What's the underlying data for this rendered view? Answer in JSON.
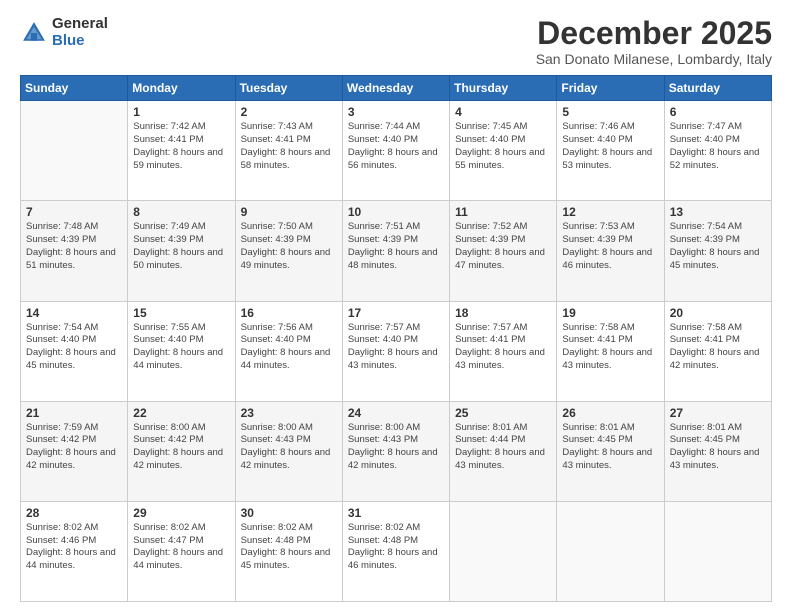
{
  "logo": {
    "general": "General",
    "blue": "Blue"
  },
  "title": {
    "month": "December 2025",
    "location": "San Donato Milanese, Lombardy, Italy"
  },
  "weekdays": [
    "Sunday",
    "Monday",
    "Tuesday",
    "Wednesday",
    "Thursday",
    "Friday",
    "Saturday"
  ],
  "weeks": [
    [
      {
        "day": "",
        "sunrise": "",
        "sunset": "",
        "daylight": ""
      },
      {
        "day": "1",
        "sunrise": "Sunrise: 7:42 AM",
        "sunset": "Sunset: 4:41 PM",
        "daylight": "Daylight: 8 hours and 59 minutes."
      },
      {
        "day": "2",
        "sunrise": "Sunrise: 7:43 AM",
        "sunset": "Sunset: 4:41 PM",
        "daylight": "Daylight: 8 hours and 58 minutes."
      },
      {
        "day": "3",
        "sunrise": "Sunrise: 7:44 AM",
        "sunset": "Sunset: 4:40 PM",
        "daylight": "Daylight: 8 hours and 56 minutes."
      },
      {
        "day": "4",
        "sunrise": "Sunrise: 7:45 AM",
        "sunset": "Sunset: 4:40 PM",
        "daylight": "Daylight: 8 hours and 55 minutes."
      },
      {
        "day": "5",
        "sunrise": "Sunrise: 7:46 AM",
        "sunset": "Sunset: 4:40 PM",
        "daylight": "Daylight: 8 hours and 53 minutes."
      },
      {
        "day": "6",
        "sunrise": "Sunrise: 7:47 AM",
        "sunset": "Sunset: 4:40 PM",
        "daylight": "Daylight: 8 hours and 52 minutes."
      }
    ],
    [
      {
        "day": "7",
        "sunrise": "Sunrise: 7:48 AM",
        "sunset": "Sunset: 4:39 PM",
        "daylight": "Daylight: 8 hours and 51 minutes."
      },
      {
        "day": "8",
        "sunrise": "Sunrise: 7:49 AM",
        "sunset": "Sunset: 4:39 PM",
        "daylight": "Daylight: 8 hours and 50 minutes."
      },
      {
        "day": "9",
        "sunrise": "Sunrise: 7:50 AM",
        "sunset": "Sunset: 4:39 PM",
        "daylight": "Daylight: 8 hours and 49 minutes."
      },
      {
        "day": "10",
        "sunrise": "Sunrise: 7:51 AM",
        "sunset": "Sunset: 4:39 PM",
        "daylight": "Daylight: 8 hours and 48 minutes."
      },
      {
        "day": "11",
        "sunrise": "Sunrise: 7:52 AM",
        "sunset": "Sunset: 4:39 PM",
        "daylight": "Daylight: 8 hours and 47 minutes."
      },
      {
        "day": "12",
        "sunrise": "Sunrise: 7:53 AM",
        "sunset": "Sunset: 4:39 PM",
        "daylight": "Daylight: 8 hours and 46 minutes."
      },
      {
        "day": "13",
        "sunrise": "Sunrise: 7:54 AM",
        "sunset": "Sunset: 4:39 PM",
        "daylight": "Daylight: 8 hours and 45 minutes."
      }
    ],
    [
      {
        "day": "14",
        "sunrise": "Sunrise: 7:54 AM",
        "sunset": "Sunset: 4:40 PM",
        "daylight": "Daylight: 8 hours and 45 minutes."
      },
      {
        "day": "15",
        "sunrise": "Sunrise: 7:55 AM",
        "sunset": "Sunset: 4:40 PM",
        "daylight": "Daylight: 8 hours and 44 minutes."
      },
      {
        "day": "16",
        "sunrise": "Sunrise: 7:56 AM",
        "sunset": "Sunset: 4:40 PM",
        "daylight": "Daylight: 8 hours and 44 minutes."
      },
      {
        "day": "17",
        "sunrise": "Sunrise: 7:57 AM",
        "sunset": "Sunset: 4:40 PM",
        "daylight": "Daylight: 8 hours and 43 minutes."
      },
      {
        "day": "18",
        "sunrise": "Sunrise: 7:57 AM",
        "sunset": "Sunset: 4:41 PM",
        "daylight": "Daylight: 8 hours and 43 minutes."
      },
      {
        "day": "19",
        "sunrise": "Sunrise: 7:58 AM",
        "sunset": "Sunset: 4:41 PM",
        "daylight": "Daylight: 8 hours and 43 minutes."
      },
      {
        "day": "20",
        "sunrise": "Sunrise: 7:58 AM",
        "sunset": "Sunset: 4:41 PM",
        "daylight": "Daylight: 8 hours and 42 minutes."
      }
    ],
    [
      {
        "day": "21",
        "sunrise": "Sunrise: 7:59 AM",
        "sunset": "Sunset: 4:42 PM",
        "daylight": "Daylight: 8 hours and 42 minutes."
      },
      {
        "day": "22",
        "sunrise": "Sunrise: 8:00 AM",
        "sunset": "Sunset: 4:42 PM",
        "daylight": "Daylight: 8 hours and 42 minutes."
      },
      {
        "day": "23",
        "sunrise": "Sunrise: 8:00 AM",
        "sunset": "Sunset: 4:43 PM",
        "daylight": "Daylight: 8 hours and 42 minutes."
      },
      {
        "day": "24",
        "sunrise": "Sunrise: 8:00 AM",
        "sunset": "Sunset: 4:43 PM",
        "daylight": "Daylight: 8 hours and 42 minutes."
      },
      {
        "day": "25",
        "sunrise": "Sunrise: 8:01 AM",
        "sunset": "Sunset: 4:44 PM",
        "daylight": "Daylight: 8 hours and 43 minutes."
      },
      {
        "day": "26",
        "sunrise": "Sunrise: 8:01 AM",
        "sunset": "Sunset: 4:45 PM",
        "daylight": "Daylight: 8 hours and 43 minutes."
      },
      {
        "day": "27",
        "sunrise": "Sunrise: 8:01 AM",
        "sunset": "Sunset: 4:45 PM",
        "daylight": "Daylight: 8 hours and 43 minutes."
      }
    ],
    [
      {
        "day": "28",
        "sunrise": "Sunrise: 8:02 AM",
        "sunset": "Sunset: 4:46 PM",
        "daylight": "Daylight: 8 hours and 44 minutes."
      },
      {
        "day": "29",
        "sunrise": "Sunrise: 8:02 AM",
        "sunset": "Sunset: 4:47 PM",
        "daylight": "Daylight: 8 hours and 44 minutes."
      },
      {
        "day": "30",
        "sunrise": "Sunrise: 8:02 AM",
        "sunset": "Sunset: 4:48 PM",
        "daylight": "Daylight: 8 hours and 45 minutes."
      },
      {
        "day": "31",
        "sunrise": "Sunrise: 8:02 AM",
        "sunset": "Sunset: 4:48 PM",
        "daylight": "Daylight: 8 hours and 46 minutes."
      },
      {
        "day": "",
        "sunrise": "",
        "sunset": "",
        "daylight": ""
      },
      {
        "day": "",
        "sunrise": "",
        "sunset": "",
        "daylight": ""
      },
      {
        "day": "",
        "sunrise": "",
        "sunset": "",
        "daylight": ""
      }
    ]
  ]
}
